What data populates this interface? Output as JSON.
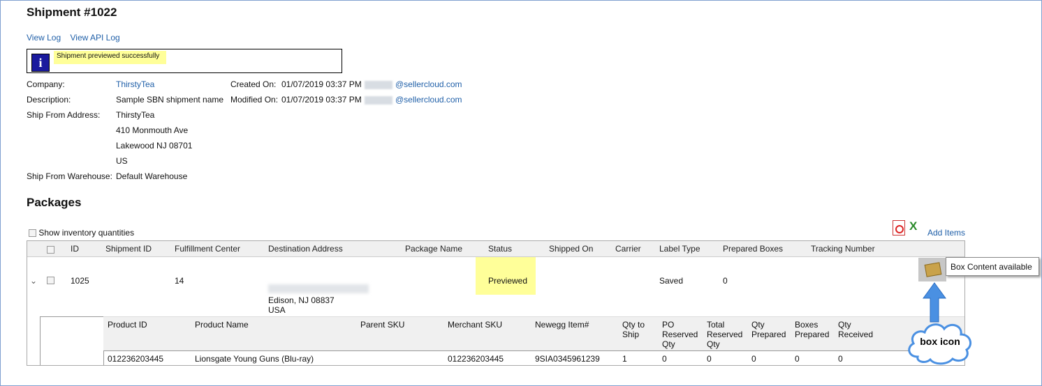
{
  "header": {
    "title": "Shipment #1022"
  },
  "links": {
    "view_log": "View Log",
    "view_api_log": "View API Log"
  },
  "message": {
    "text": "Shipment previewed successfully"
  },
  "details": {
    "company_label": "Company:",
    "company_value": "ThirstyTea",
    "description_label": "Description:",
    "description_value": "Sample SBN shipment name",
    "ship_from_label": "Ship From Address:",
    "address_line1": "ThirstyTea",
    "address_line2": "410 Monmouth Ave",
    "address_line3": "Lakewood NJ 08701",
    "address_line4": "US",
    "warehouse_label": "Ship From Warehouse:",
    "warehouse_value": "Default Warehouse",
    "created_label": "Created On:",
    "created_value": "01/07/2019 03:37 PM",
    "created_email": "@sellercloud.com",
    "modified_label": "Modified On:",
    "modified_value": "01/07/2019 03:37 PM",
    "modified_email": "@sellercloud.com"
  },
  "packages": {
    "title": "Packages",
    "show_inventory": "Show inventory quantities",
    "add_items": "Add Items",
    "columns": [
      "ID",
      "Shipment ID",
      "Fulfillment Center",
      "Destination Address",
      "Package Name",
      "Status",
      "Shipped On",
      "Carrier",
      "Label Type",
      "Prepared Boxes",
      "Tracking Number"
    ],
    "row": {
      "id": "1025",
      "fulfillment_center": "14",
      "address_line2": "Edison, NJ 08837",
      "address_line3": "USA",
      "status": "Previewed",
      "label_type": "Saved",
      "prepared_boxes": "0"
    },
    "sub_columns": {
      "product_id": "Product ID",
      "product_name": "Product Name",
      "parent_sku": "Parent SKU",
      "merchant_sku": "Merchant SKU",
      "newegg_item": "Newegg Item#",
      "qty_to_ship_1": "Qty to",
      "qty_to_ship_2": "Ship",
      "po_reserved_1": "PO",
      "po_reserved_2": "Reserved",
      "po_reserved_3": "Qty",
      "total_reserved_1": "Total",
      "total_reserved_2": "Reserved",
      "total_reserved_3": "Qty",
      "qty_prepared_1": "Qty",
      "qty_prepared_2": "Prepared",
      "boxes_prepared_1": "Boxes",
      "boxes_prepared_2": "Prepared",
      "qty_received_1": "Qty",
      "qty_received_2": "Received"
    },
    "item": {
      "product_id": "012236203445",
      "product_name": "Lionsgate Young Guns (Blu-ray)",
      "merchant_sku": "012236203445",
      "newegg_item": "9SIA0345961239",
      "qty_to_ship": "1",
      "po_reserved": "0",
      "total_reserved": "0",
      "qty_prepared": "0",
      "boxes_prepared": "0",
      "qty_received": "0"
    }
  },
  "tooltip": {
    "text": "Box Content available"
  },
  "callout": {
    "text": "box icon"
  },
  "colors": {
    "link": "#1f5fa8",
    "highlight": "#ffff99",
    "callout_arrow": "#4a90e2"
  },
  "icons": {
    "info": "info-icon",
    "pdf": "pdf-icon",
    "excel": "excel-icon",
    "box": "box-icon",
    "expand": "chevron-down-icon"
  }
}
